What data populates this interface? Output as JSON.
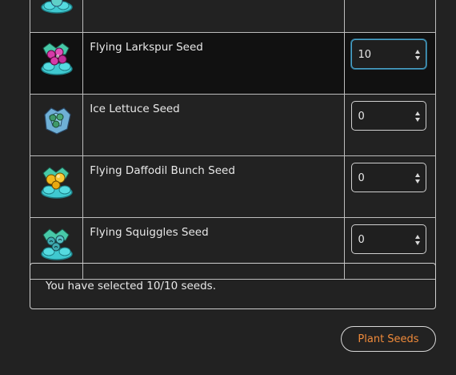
{
  "seeds": [
    {
      "name": "",
      "icon": "flying-seed-icon",
      "quantity": "",
      "colors": {
        "bloom": "#5fd0c8",
        "cloud": "#3fc9d0"
      }
    },
    {
      "name": "Flying Larkspur Seed",
      "icon": "flying-larkspur-seed-icon",
      "quantity": "10",
      "colors": {
        "bloom": "#d63aa8",
        "cloud": "#3fc9d0"
      }
    },
    {
      "name": "Ice Lettuce Seed",
      "icon": "ice-lettuce-seed-icon",
      "quantity": "0",
      "colors": {
        "bloom": "#3f9a6a",
        "cloud": "#7fb6d8"
      }
    },
    {
      "name": "Flying Daffodil Bunch Seed",
      "icon": "flying-daffodil-bunch-seed-icon",
      "quantity": "0",
      "colors": {
        "bloom": "#f2b81c",
        "cloud": "#3fc9d0"
      }
    },
    {
      "name": "Flying Squiggles Seed",
      "icon": "flying-squiggles-seed-icon",
      "quantity": "0",
      "colors": {
        "bloom": "#3faab0",
        "cloud": "#3fc9d0"
      }
    }
  ],
  "status": {
    "message": "You have selected 10/10 seeds."
  },
  "actions": {
    "plant_label": "Plant Seeds"
  },
  "theme": {
    "accent": "#f08a3a",
    "focus": "#4aa3c9",
    "background": "#222222"
  }
}
